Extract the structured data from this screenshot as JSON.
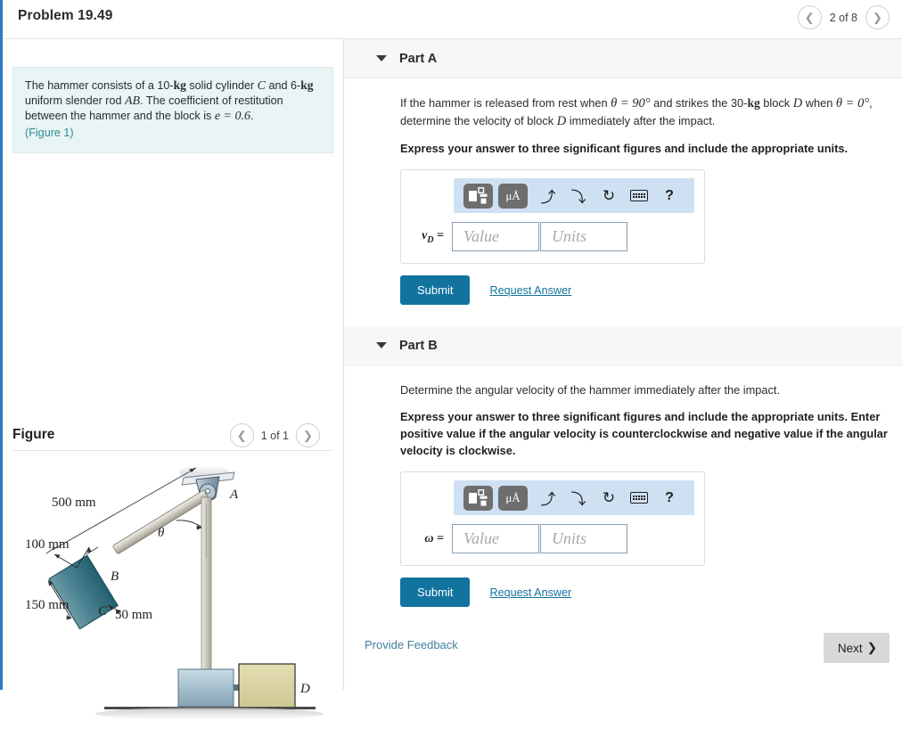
{
  "header": {
    "problem_title": "Problem 19.49",
    "pager": {
      "prev_icon": "chevron-left-icon",
      "next_icon": "chevron-right-icon",
      "count": "2 of 8"
    }
  },
  "statement": {
    "line1_a": "The hammer consists of a 10-",
    "line1_kg": "kg",
    "line1_b": " solid cylinder ",
    "line1_c": "C",
    "line1_d": " and 6-",
    "line2_kg": "kg",
    "line2_a": " uniform slender rod ",
    "line2_ab": "AB",
    "line2_b": ". The coefficient of restitution between the hammer and the block is ",
    "line3_e": "e = 0.6",
    "line3_period": ".",
    "figure_link": "(Figure 1)"
  },
  "figure": {
    "title": "Figure",
    "pager_count": "1 of 1",
    "prev_icon": "chevron-left-icon",
    "next_icon": "chevron-right-icon",
    "labels": {
      "dim_500": "500 mm",
      "dim_100": "100 mm",
      "dim_150": "150 mm",
      "dim_50": "50 mm",
      "point_a": "A",
      "point_b": "B",
      "point_c": "C",
      "point_d": "D",
      "theta": "θ"
    },
    "colors": {
      "cylinder_c": "#3e7d8c",
      "hammer_head": "#a7bfcd",
      "block_d": "#d9d4a0",
      "rod": "#c9c6bb",
      "pivot": "#8fa6b8",
      "ground": "#4a4a4a"
    }
  },
  "parts": [
    {
      "label": "Part A",
      "question_pre": "If the hammer is released from rest when ",
      "question_theta1": "θ = 90°",
      "question_mid": " and strikes the 30-",
      "question_kg": "kg",
      "question_mid2": " block ",
      "question_d": "D",
      "question_mid3": " when ",
      "question_theta2": "θ = 0°",
      "question_end": ", determine the velocity of block ",
      "question_d2": "D",
      "question_end2": " immediately after the impact.",
      "instruction": "Express your answer to three significant figures and include the appropriate units.",
      "variable": "v",
      "variable_sub": "D",
      "equals": "=",
      "value_placeholder": "Value",
      "units_placeholder": "Units",
      "value": "",
      "units": "",
      "submit_label": "Submit",
      "request_label": "Request Answer"
    },
    {
      "label": "Part B",
      "question": "Determine the angular velocity of the hammer immediately after the impact.",
      "instruction": "Express your answer to three significant figures and include the appropriate units. Enter positive value if the angular velocity is counterclockwise and negative value if the angular velocity is clockwise.",
      "variable": "ω",
      "variable_sub": "",
      "equals": "=",
      "value_placeholder": "Value",
      "units_placeholder": "Units",
      "value": "",
      "units": "",
      "submit_label": "Submit",
      "request_label": "Request Answer"
    }
  ],
  "toolbar": {
    "template_icon": "math-template-icon",
    "units_icon": "μÅ",
    "undo_icon": "undo-arrow-icon",
    "redo_icon": "redo-arrow-icon",
    "reset_icon": "reset-circle-icon",
    "keyboard_icon": "keyboard-icon",
    "help_icon": "?"
  },
  "footer": {
    "feedback_label": "Provide Feedback",
    "next_label": "Next",
    "next_chevron": "❯"
  },
  "colors": {
    "accent_blue": "#2e7cc4",
    "submit_teal": "#11739e",
    "statement_bg": "#e9f4f4",
    "toolbar_blue": "#cfe0f2",
    "part_header_bg": "#f7f7f7"
  }
}
